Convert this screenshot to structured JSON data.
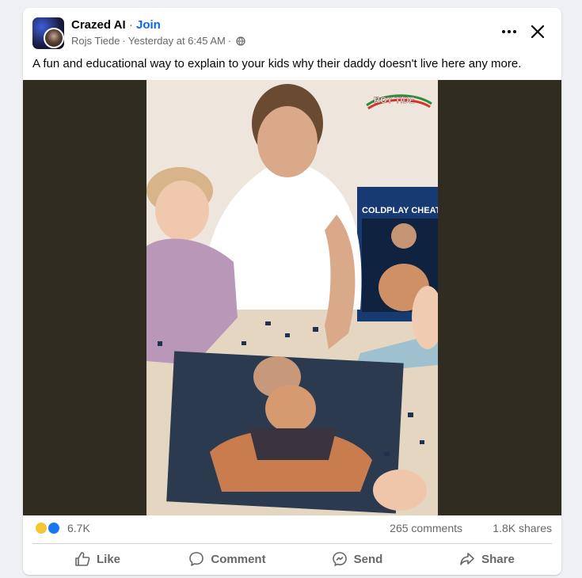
{
  "post": {
    "group_name": "Crazed AI",
    "separator": "·",
    "join_label": "Join",
    "author": "Rojs Tiede",
    "time": "Yesterday at 6:45 AM",
    "visibility_icon": "globe-icon",
    "caption": "A fun and educational way to explain to your kids why their daddy doesn't live here any more.",
    "more_icon": "more-options-icon",
    "close_icon": "close-icon"
  },
  "image": {
    "watermark": "ROY TIDE",
    "box_title": "COLDPLAY CHEATE"
  },
  "stats": {
    "reactions": [
      "haha",
      "like"
    ],
    "reaction_count": "6.7K",
    "comments": "265 comments",
    "shares": "1.8K shares"
  },
  "actions": [
    {
      "label": "Like",
      "icon": "like-icon"
    },
    {
      "label": "Comment",
      "icon": "comment-icon"
    },
    {
      "label": "Send",
      "icon": "send-icon"
    },
    {
      "label": "Share",
      "icon": "share-icon"
    }
  ],
  "colors": {
    "link_blue": "#0866ff",
    "secondary_text": "#65676b",
    "media_letterbox": "#302c22"
  }
}
